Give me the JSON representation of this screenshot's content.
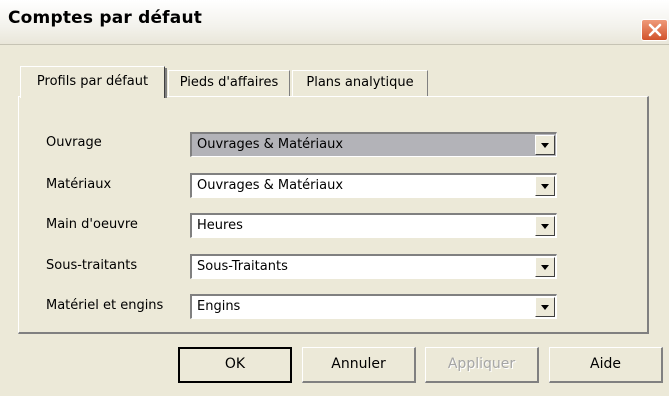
{
  "window": {
    "title": "Comptes par défaut",
    "close_icon": "close-icon",
    "close_color": "#d2532b"
  },
  "tabs": [
    {
      "label": "Profils par défaut",
      "active": true
    },
    {
      "label": "Pieds d'affaires",
      "active": false
    },
    {
      "label": "Plans analytique",
      "active": false
    }
  ],
  "fields": [
    {
      "label": "Ouvrage",
      "value": "Ouvrages & Matériaux"
    },
    {
      "label": "Matériaux",
      "value": "Ouvrages & Matériaux"
    },
    {
      "label": "Main d'oeuvre",
      "value": "Heures"
    },
    {
      "label": "Sous-traitants",
      "value": "Sous-Traitants"
    },
    {
      "label": "Matériel et engins",
      "value": "Engins"
    }
  ],
  "buttons": {
    "ok": "OK",
    "cancel": "Annuler",
    "apply": "Appliquer",
    "help": "Aide"
  }
}
